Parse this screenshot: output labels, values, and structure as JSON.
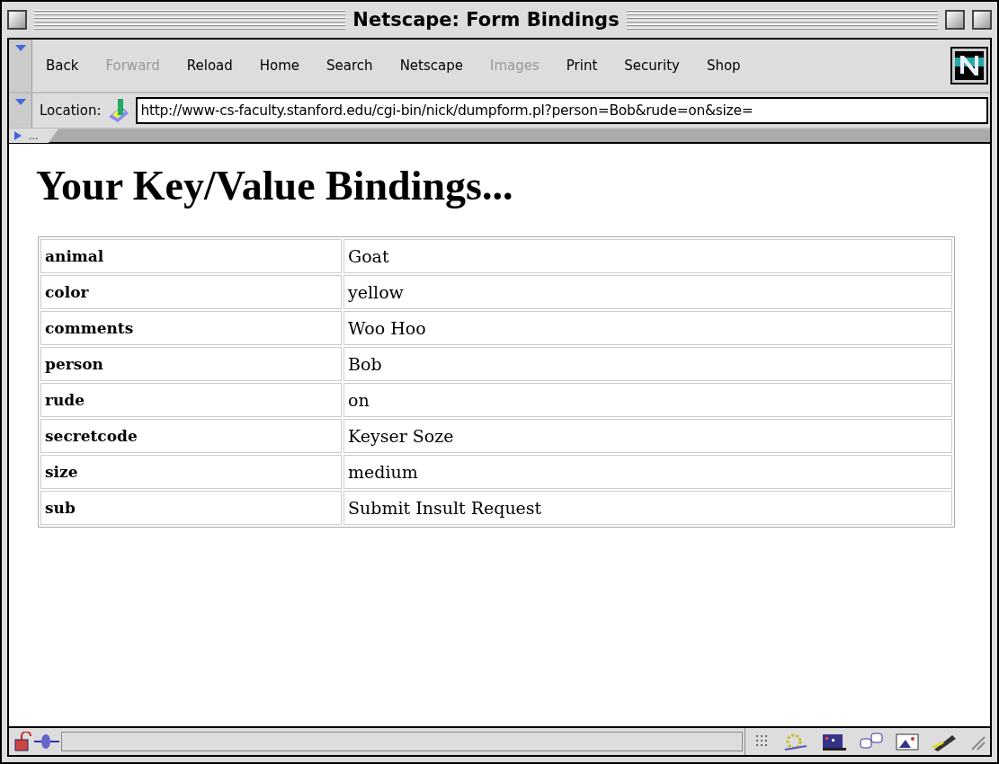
{
  "window": {
    "title": "Netscape: Form Bindings"
  },
  "toolbar": [
    {
      "label": "Back",
      "disabled": false
    },
    {
      "label": "Forward",
      "disabled": true
    },
    {
      "label": "Reload",
      "disabled": false
    },
    {
      "label": "Home",
      "disabled": false
    },
    {
      "label": "Search",
      "disabled": false
    },
    {
      "label": "Netscape",
      "disabled": false
    },
    {
      "label": "Images",
      "disabled": true
    },
    {
      "label": "Print",
      "disabled": false
    },
    {
      "label": "Security",
      "disabled": false
    },
    {
      "label": "Shop",
      "disabled": false
    }
  ],
  "location": {
    "label": "Location:",
    "value": "http://www-cs-faculty.stanford.edu/cgi-bin/nick/dumpform.pl?person=Bob&rude=on&size="
  },
  "tab_strip": {
    "label": "..."
  },
  "page": {
    "heading": "Your Key/Value Bindings...",
    "rows": [
      {
        "key": "animal",
        "value": "Goat"
      },
      {
        "key": "color",
        "value": "yellow"
      },
      {
        "key": "comments",
        "value": "Woo Hoo"
      },
      {
        "key": "person",
        "value": "Bob"
      },
      {
        "key": "rude",
        "value": "on"
      },
      {
        "key": "secretcode",
        "value": "Keyser Soze"
      },
      {
        "key": "size",
        "value": "medium"
      },
      {
        "key": "sub",
        "value": "Submit Insult Request"
      }
    ]
  }
}
